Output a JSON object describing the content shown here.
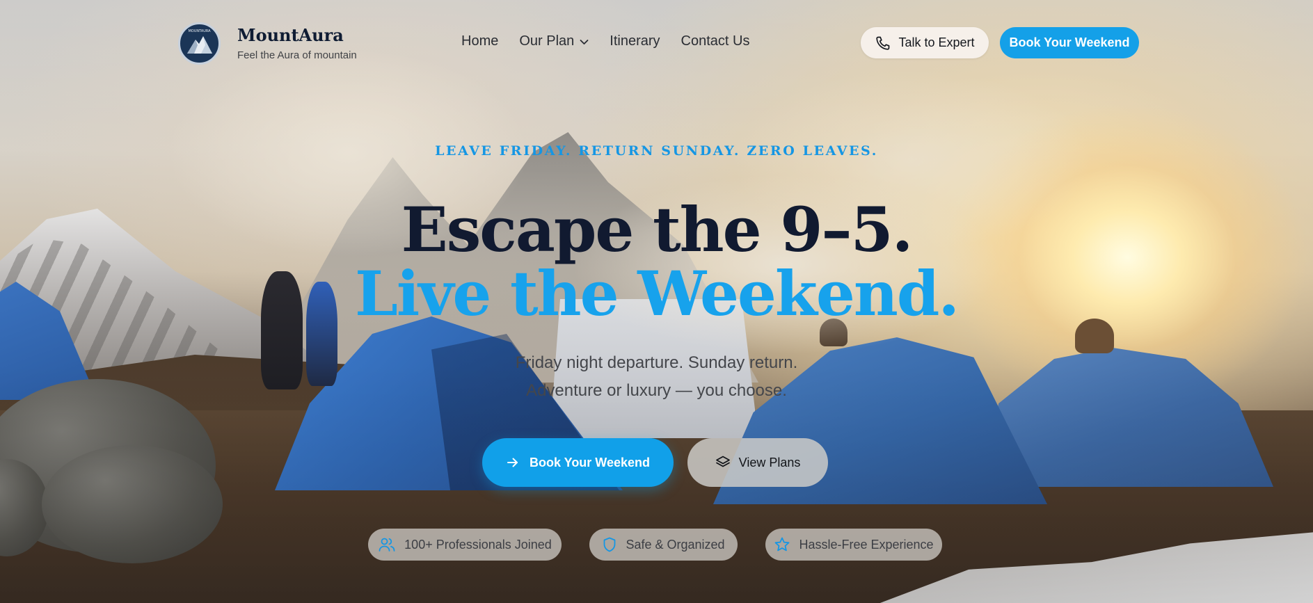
{
  "brand": {
    "name": "MountAura",
    "tagline": "Feel the Aura of mountain",
    "logo_text": "MOUNTAURA"
  },
  "nav": {
    "items": [
      {
        "label": "Home"
      },
      {
        "label": "Our Plan",
        "has_dropdown": true
      },
      {
        "label": "Itinerary"
      },
      {
        "label": "Contact Us"
      }
    ]
  },
  "header_actions": {
    "expert_label": "Talk to Expert",
    "expert_icon": "phone-icon",
    "book_label": "Book Your Weekend"
  },
  "hero": {
    "eyebrow": "LEAVE FRIDAY. RETURN SUNDAY. ZERO LEAVES.",
    "headline_1": "Escape the 9–5.",
    "headline_2": "Live the Weekend.",
    "subtitle_1": "Friday night departure. Sunday return.",
    "subtitle_2": "Adventure or luxury — you choose.",
    "cta_primary": "Book Your Weekend",
    "cta_primary_icon": "arrow-right-icon",
    "cta_secondary": "View Plans",
    "cta_secondary_icon": "layers-icon"
  },
  "badges": [
    {
      "label": "100+ Professionals Joined",
      "icon": "users-icon"
    },
    {
      "label": "Safe & Organized",
      "icon": "shield-icon"
    },
    {
      "label": "Hassle-Free Experience",
      "icon": "star-icon"
    }
  ],
  "colors": {
    "accent": "#14a0e8",
    "heading_dark": "#111a30",
    "expert_button_bg": "#f6f0ea"
  }
}
